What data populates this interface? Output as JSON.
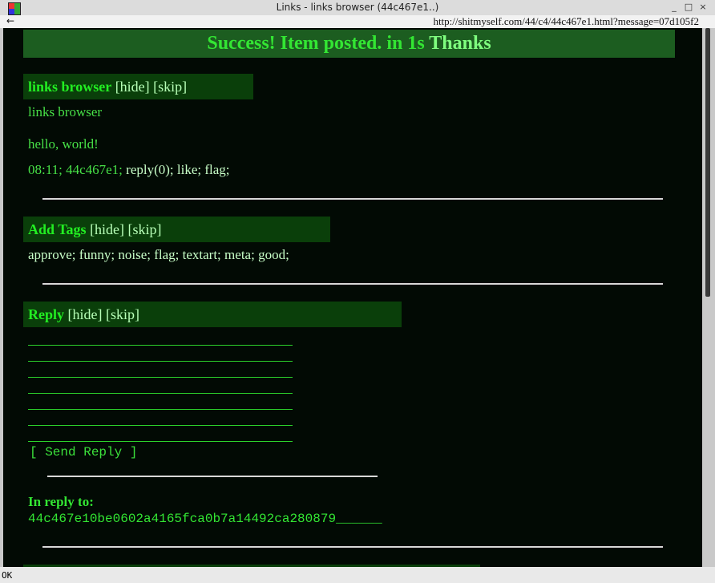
{
  "window": {
    "title": "Links - links browser (44c467e1..)",
    "controls": [
      "_",
      "□",
      "×"
    ]
  },
  "toolbar": {
    "back_label": "←",
    "url": "http://shitmyself.com/44/c4/44c467e1.html?message=07d105f2"
  },
  "banner": {
    "message": "Success! Item posted. in 1s",
    "thanks": "Thanks"
  },
  "post": {
    "section_title": "links browser",
    "hide": "[hide]",
    "skip": "[skip]",
    "title": "links browser",
    "body": "hello, world!",
    "meta": {
      "time": "08:11;",
      "id": "44c467e1;",
      "reply": "reply(0);",
      "like": "like;",
      "flag": "flag;"
    }
  },
  "tags": {
    "section_title": "Add Tags",
    "hide": "[hide]",
    "skip": "[skip]",
    "items": [
      "approve;",
      "funny;",
      "noise;",
      "flag;",
      "textart;",
      "meta;",
      "good;"
    ]
  },
  "reply": {
    "section_title": "Reply",
    "hide": "[hide]",
    "skip": "[skip]",
    "send_label": "[ Send Reply ]",
    "in_reply_to_label": "In reply to:",
    "in_reply_to_value": "44c467e10be0602a4165fca0b7a14492ca280879______"
  },
  "status": {
    "text": "OK"
  },
  "colors": {
    "background": "#020a04",
    "banner_bg": "#1c5d20",
    "section_bg": "#0a3f0a",
    "text_green": "#47e047",
    "link_light": "#c8ffc8"
  }
}
